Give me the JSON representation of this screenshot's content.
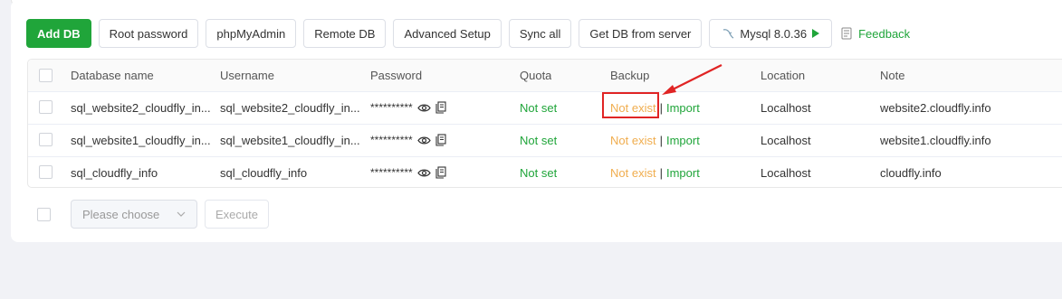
{
  "toolbar": {
    "add_db": "Add DB",
    "root_password": "Root password",
    "phpmyadmin": "phpMyAdmin",
    "remote_db": "Remote DB",
    "advanced_setup": "Advanced Setup",
    "sync_all": "Sync all",
    "get_db": "Get DB from server",
    "mysql_version": "Mysql 8.0.36",
    "feedback": "Feedback"
  },
  "table": {
    "columns": [
      "Database name",
      "Username",
      "Password",
      "Quota",
      "Backup",
      "Location",
      "Note"
    ],
    "rows": [
      {
        "name": "sql_website2_cloudfly_in...",
        "user": "sql_website2_cloudfly_in...",
        "password": "**********",
        "quota": "Not set",
        "backup": "Not exist",
        "import": "Import",
        "location": "Localhost",
        "note": "website2.cloudfly.info"
      },
      {
        "name": "sql_website1_cloudfly_in...",
        "user": "sql_website1_cloudfly_in...",
        "password": "**********",
        "quota": "Not set",
        "backup": "Not exist",
        "import": "Import",
        "location": "Localhost",
        "note": "website1.cloudfly.info"
      },
      {
        "name": "sql_cloudfly_info",
        "user": "sql_cloudfly_info",
        "password": "**********",
        "quota": "Not set",
        "backup": "Not exist",
        "import": "Import",
        "location": "Localhost",
        "note": "cloudfly.info"
      }
    ],
    "separator": "|"
  },
  "bottom": {
    "select_placeholder": "Please choose",
    "execute": "Execute"
  },
  "colors": {
    "accent": "#20a53a",
    "warning": "#f0ad4e",
    "annotation": "#e02424"
  },
  "icons": [
    "mysql-dolphin-icon",
    "play-icon",
    "feedback-icon",
    "eye-icon",
    "copy-icon",
    "chevron-down-icon"
  ]
}
